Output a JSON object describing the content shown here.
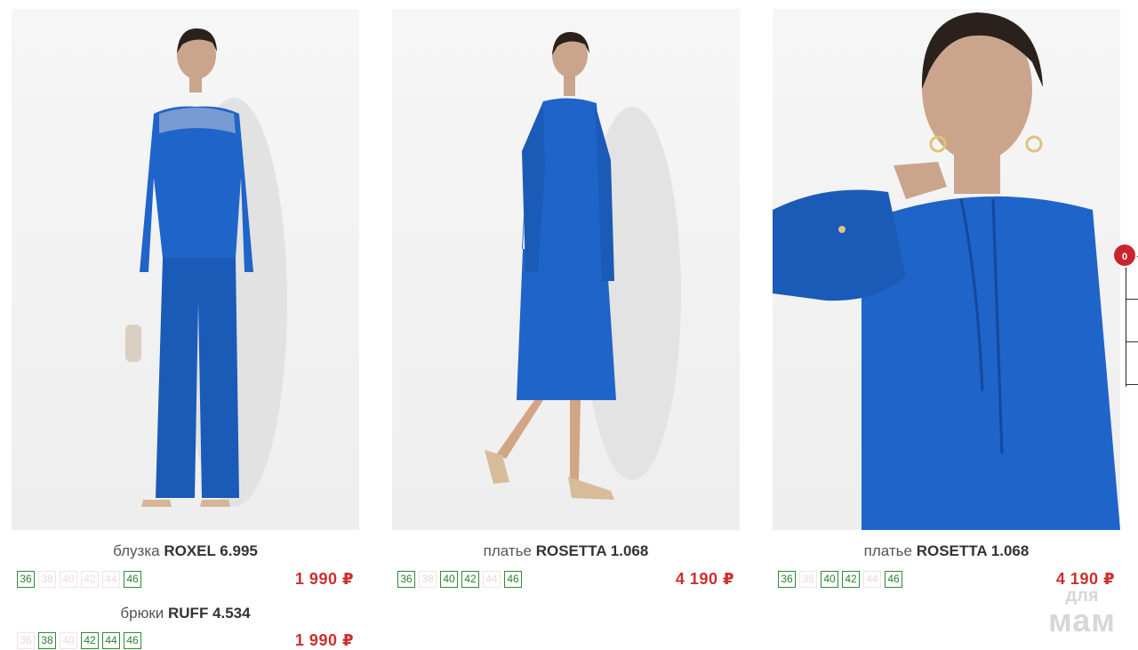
{
  "products": [
    {
      "items": [
        {
          "type": "блузка",
          "name": "ROXEL 6.995",
          "price": "1 990 ₽",
          "sizes": [
            {
              "label": "36",
              "available": true
            },
            {
              "label": "38",
              "available": false
            },
            {
              "label": "40",
              "available": false
            },
            {
              "label": "42",
              "available": false
            },
            {
              "label": "44",
              "available": false
            },
            {
              "label": "46",
              "available": true
            }
          ]
        },
        {
          "type": "брюки",
          "name": "RUFF 4.534",
          "price": "1 990 ₽",
          "sizes": [
            {
              "label": "36",
              "available": false
            },
            {
              "label": "38",
              "available": true
            },
            {
              "label": "40",
              "available": false
            },
            {
              "label": "42",
              "available": true
            },
            {
              "label": "44",
              "available": true
            },
            {
              "label": "46",
              "available": true
            }
          ]
        }
      ]
    },
    {
      "items": [
        {
          "type": "платье",
          "name": "ROSETTA 1.068",
          "price": "4 190 ₽",
          "sizes": [
            {
              "label": "36",
              "available": true
            },
            {
              "label": "38",
              "available": false
            },
            {
              "label": "40",
              "available": true
            },
            {
              "label": "42",
              "available": true
            },
            {
              "label": "44",
              "available": false
            },
            {
              "label": "46",
              "available": true
            }
          ]
        }
      ]
    },
    {
      "items": [
        {
          "type": "платье",
          "name": "ROSETTA 1.068",
          "price": "4 190 ₽",
          "sizes": [
            {
              "label": "36",
              "available": true
            },
            {
              "label": "38",
              "available": false
            },
            {
              "label": "40",
              "available": true
            },
            {
              "label": "42",
              "available": true
            },
            {
              "label": "44",
              "available": false
            },
            {
              "label": "46",
              "available": true
            }
          ]
        }
      ]
    }
  ],
  "cart": {
    "count": "0"
  },
  "watermark": {
    "line1": "для",
    "line2": "мам"
  },
  "colors": {
    "garment": "#1f64c8",
    "price": "#cc2f2f",
    "size_border": "#2e8b3a",
    "badge": "#c8262e"
  }
}
